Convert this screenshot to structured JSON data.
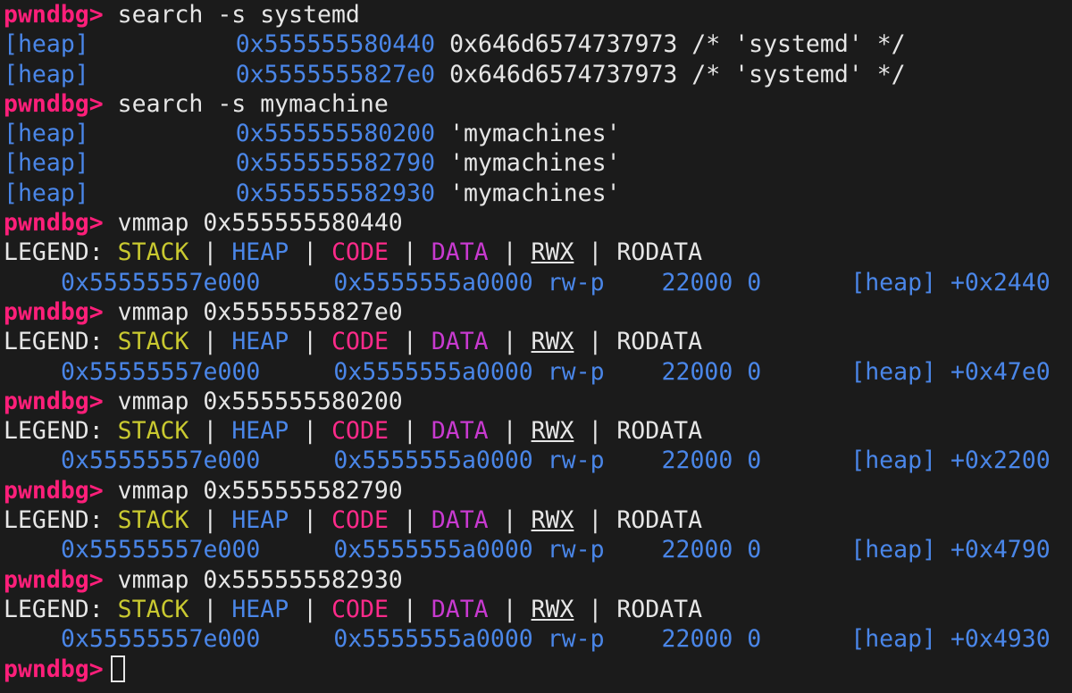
{
  "prompt": "pwndbg>",
  "commands": {
    "search_systemd": "search -s systemd",
    "search_mymachine": "search -s mymachine",
    "vmmap_1": "vmmap 0x555555580440",
    "vmmap_2": "vmmap 0x5555555827e0",
    "vmmap_3": "vmmap 0x555555580200",
    "vmmap_4": "vmmap 0x555555582790",
    "vmmap_5": "vmmap 0x555555582930"
  },
  "search_results_systemd": [
    {
      "region": "[heap]",
      "address": "0x555555580440",
      "value": "0x646d6574737973 /* 'systemd' */"
    },
    {
      "region": "[heap]",
      "address": "0x5555555827e0",
      "value": "0x646d6574737973 /* 'systemd' */"
    }
  ],
  "search_results_mymachine": [
    {
      "region": "[heap]",
      "address": "0x555555580200",
      "value": "'mymachines'"
    },
    {
      "region": "[heap]",
      "address": "0x555555582790",
      "value": "'mymachines'"
    },
    {
      "region": "[heap]",
      "address": "0x555555582930",
      "value": "'mymachines'"
    }
  ],
  "legend": {
    "label": "LEGEND:",
    "stack": "STACK",
    "heap": "HEAP",
    "code": "CODE",
    "data": "DATA",
    "rwx": "RWX",
    "rodata": "RODATA",
    "sep": "|"
  },
  "vmmap_rows": [
    {
      "start": "0x55555557e000",
      "end": "0x5555555a0000",
      "perm": "rw-p",
      "size": "22000",
      "offset": "0",
      "name": "[heap]",
      "delta": "+0x2440"
    },
    {
      "start": "0x55555557e000",
      "end": "0x5555555a0000",
      "perm": "rw-p",
      "size": "22000",
      "offset": "0",
      "name": "[heap]",
      "delta": "+0x47e0"
    },
    {
      "start": "0x55555557e000",
      "end": "0x5555555a0000",
      "perm": "rw-p",
      "size": "22000",
      "offset": "0",
      "name": "[heap]",
      "delta": "+0x2200"
    },
    {
      "start": "0x55555557e000",
      "end": "0x5555555a0000",
      "perm": "rw-p",
      "size": "22000",
      "offset": "0",
      "name": "[heap]",
      "delta": "+0x4790"
    },
    {
      "start": "0x55555557e000",
      "end": "0x5555555a0000",
      "perm": "rw-p",
      "size": "22000",
      "offset": "0",
      "name": "[heap]",
      "delta": "+0x4930"
    }
  ],
  "colors": {
    "background": "#1b1b1b",
    "prompt": "#ff1f7a",
    "address": "#4a86e8",
    "stack": "#c9c930",
    "code": "#ff2a8a",
    "data": "#c83ad0",
    "text": "#e6e6e6"
  }
}
